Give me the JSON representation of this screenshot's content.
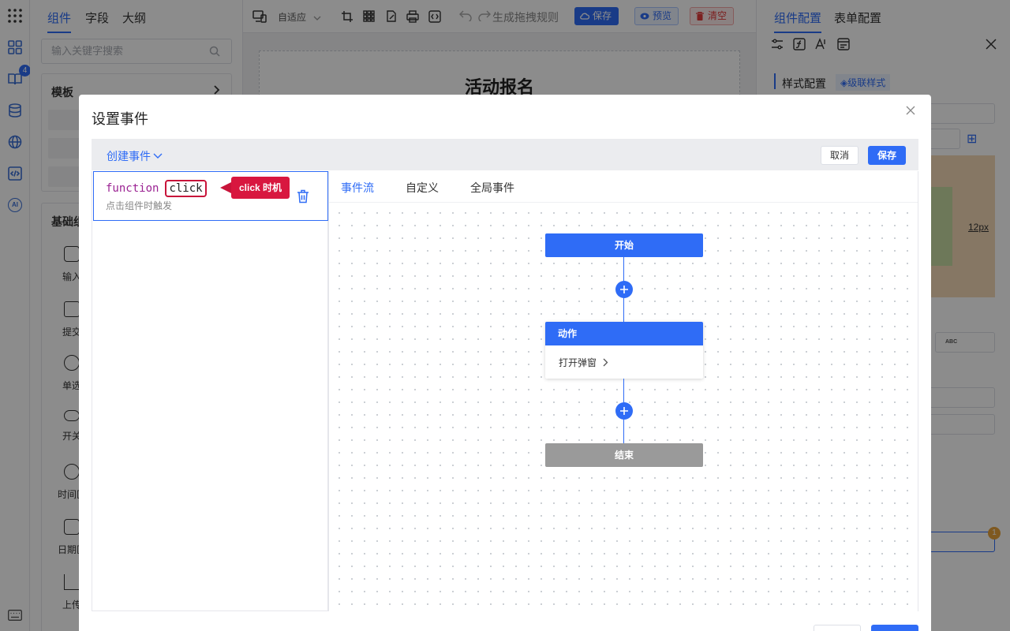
{
  "left_panel": {
    "tabs": [
      "组件",
      "字段",
      "大纲"
    ],
    "search_placeholder": "输入关键字搜索",
    "template_section": "模板",
    "basic_section": "基础组",
    "components": [
      "输入",
      "提交",
      "单选",
      "开关",
      "时间区",
      "日期区",
      "上传"
    ]
  },
  "rail": {
    "badge": "4",
    "ai": "AI"
  },
  "toolbar": {
    "layout": "自适应",
    "rule": "生成拖拽规则",
    "save": "保存",
    "preview": "预览",
    "clear": "清空"
  },
  "canvas": {
    "form_title": "活动报名"
  },
  "right_panel": {
    "tabs": [
      "组件配置",
      "表单配置"
    ],
    "style_config": "样式配置",
    "cascade_style": "级联样式",
    "px_value": "12px",
    "abc": "ABC",
    "badge": "1"
  },
  "modal": {
    "title": "设置事件",
    "create_event": "创建事件",
    "cancel": "取消",
    "save": "保存",
    "event": {
      "keyword": "function",
      "name": "click",
      "description": "点击组件时触发",
      "callout": "click 时机"
    },
    "flow_tabs": [
      "事件流",
      "自定义",
      "全局事件"
    ],
    "flow": {
      "start": "开始",
      "action_title": "动作",
      "action_item": "打开弹窗",
      "end": "结束"
    }
  }
}
